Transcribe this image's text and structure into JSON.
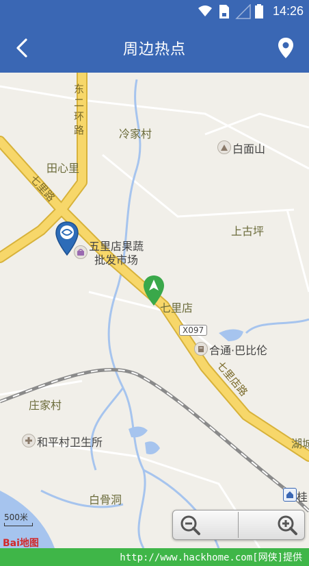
{
  "status_bar": {
    "time": "14:26"
  },
  "app_bar": {
    "title": "周边热点"
  },
  "map": {
    "labels": {
      "dong_er_huan_lu": "东二环路",
      "leng_jia_cun": "冷家村",
      "bai_mian_shan": "白面山",
      "tian_xin_li": "田心里",
      "qi_li_lu_nw": "七里路",
      "shang_gu_ping": "上古坪",
      "wu_li_dian_line1": "五里店果蔬",
      "wu_li_dian_line2": "批发市场",
      "qi_li_dian": "七里店",
      "he_tong_ba_bi_lun": "合通·巴比伦",
      "qi_li_lu_se": "七里店路",
      "zhuang_jia_cun": "庄家村",
      "he_ping_cun": "和平村卫生所",
      "hu_cheng": "湖城",
      "bai_gu_dong": "白骨洞",
      "gui": "桂"
    },
    "road_shield": "X097",
    "scale_label": "500米",
    "logo": "Bai地图"
  },
  "footer": {
    "watermark": "http://www.hackhome.com[网侠]提供"
  }
}
